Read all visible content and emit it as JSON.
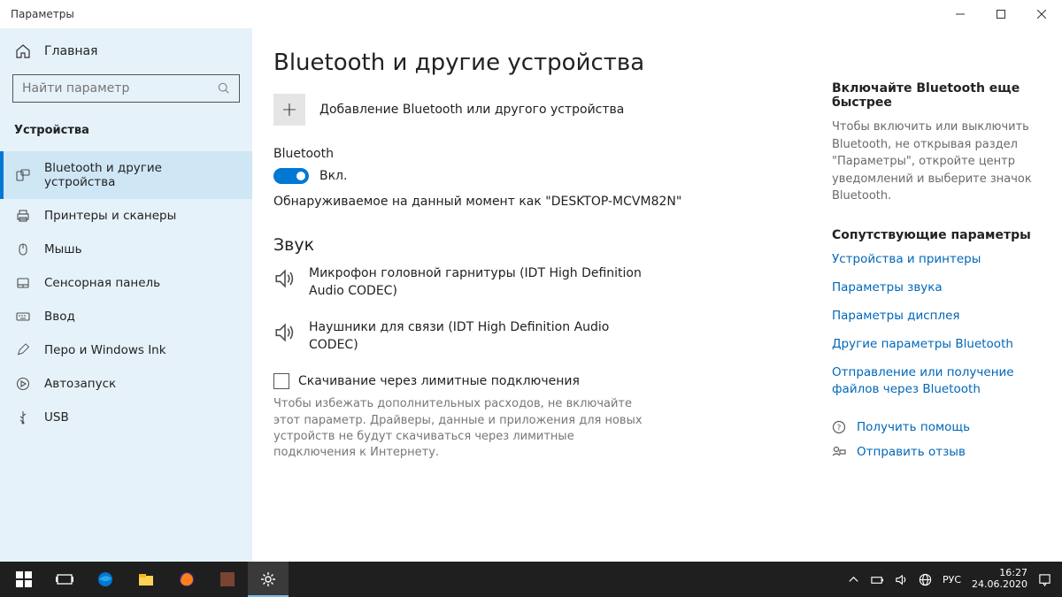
{
  "titlebar": {
    "title": "Параметры"
  },
  "sidebar": {
    "home": "Главная",
    "search_placeholder": "Найти параметр",
    "category": "Устройства",
    "items": [
      {
        "label": "Bluetooth и другие устройства"
      },
      {
        "label": "Принтеры и сканеры"
      },
      {
        "label": "Мышь"
      },
      {
        "label": "Сенсорная панель"
      },
      {
        "label": "Ввод"
      },
      {
        "label": "Перо и Windows Ink"
      },
      {
        "label": "Автозапуск"
      },
      {
        "label": "USB"
      }
    ]
  },
  "content": {
    "heading": "Bluetooth и другие устройства",
    "add_device_label": "Добавление Bluetooth или другого устройства",
    "bt_label": "Bluetooth",
    "bt_state": "Вкл.",
    "discoverable": "Обнаруживаемое на данный момент как \"DESKTOP-MCVM82N\"",
    "audio_section": "Звук",
    "devices": [
      {
        "label": "Микрофон головной гарнитуры (IDT High Definition Audio CODEC)"
      },
      {
        "label": "Наушники для связи (IDT High Definition Audio CODEC)"
      }
    ],
    "metered_label": "Скачивание через лимитные подключения",
    "metered_help": "Чтобы избежать дополнительных расходов, не включайте этот параметр. Драйверы, данные и приложения для новых устройств не будут скачиваться через лимитные подключения к Интернету."
  },
  "right": {
    "tip_title": "Включайте Bluetooth еще быстрее",
    "tip_text": "Чтобы включить или выключить Bluetooth, не открывая раздел \"Параметры\", откройте центр уведомлений и выберите значок Bluetooth.",
    "related_title": "Сопутствующие параметры",
    "links": [
      "Устройства и принтеры",
      "Параметры звука",
      "Параметры дисплея",
      "Другие параметры Bluetooth",
      "Отправление или получение файлов через Bluetooth"
    ],
    "help": "Получить помощь",
    "feedback": "Отправить отзыв"
  },
  "taskbar": {
    "lang": "РУС",
    "time": "16:27",
    "date": "24.06.2020"
  }
}
